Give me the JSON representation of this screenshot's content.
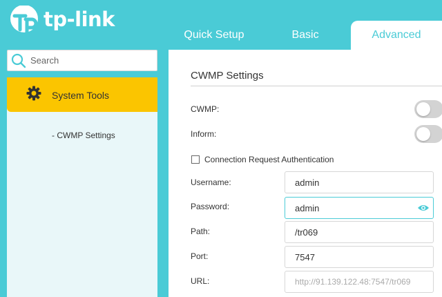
{
  "brand": {
    "name": "tp-link"
  },
  "tabs": [
    {
      "label": "Quick Setup",
      "active": false
    },
    {
      "label": "Basic",
      "active": false
    },
    {
      "label": "Advanced",
      "active": true
    }
  ],
  "search": {
    "placeholder": "Search",
    "icon": "search-icon"
  },
  "sidebar": {
    "active_item": {
      "label": "System Tools",
      "icon": "gear-icon"
    },
    "subitems": [
      {
        "label": "- CWMP Settings"
      }
    ]
  },
  "cwmp": {
    "title": "CWMP Settings",
    "cwmp_toggle": {
      "label": "CWMP:",
      "on": false
    },
    "inform_toggle": {
      "label": "Inform:",
      "on": false
    },
    "auth_checkbox": {
      "label": "Connection Request Authentication",
      "checked": false
    },
    "fields": {
      "username": {
        "label": "Username:",
        "value": "admin"
      },
      "password": {
        "label": "Password:",
        "value": "admin",
        "icon": "eye-icon"
      },
      "path": {
        "label": "Path:",
        "value": "/tr069"
      },
      "port": {
        "label": "Port:",
        "value": "7547"
      },
      "url": {
        "label": "URL:",
        "value": "",
        "placeholder": "http://91.139.122.48:7547/tr069"
      }
    }
  },
  "colors": {
    "accent": "#4acbd6",
    "menu_active": "#fbc500",
    "sidebar_bg": "#e9f7f9",
    "toggle_off": "#d3d3d3"
  }
}
